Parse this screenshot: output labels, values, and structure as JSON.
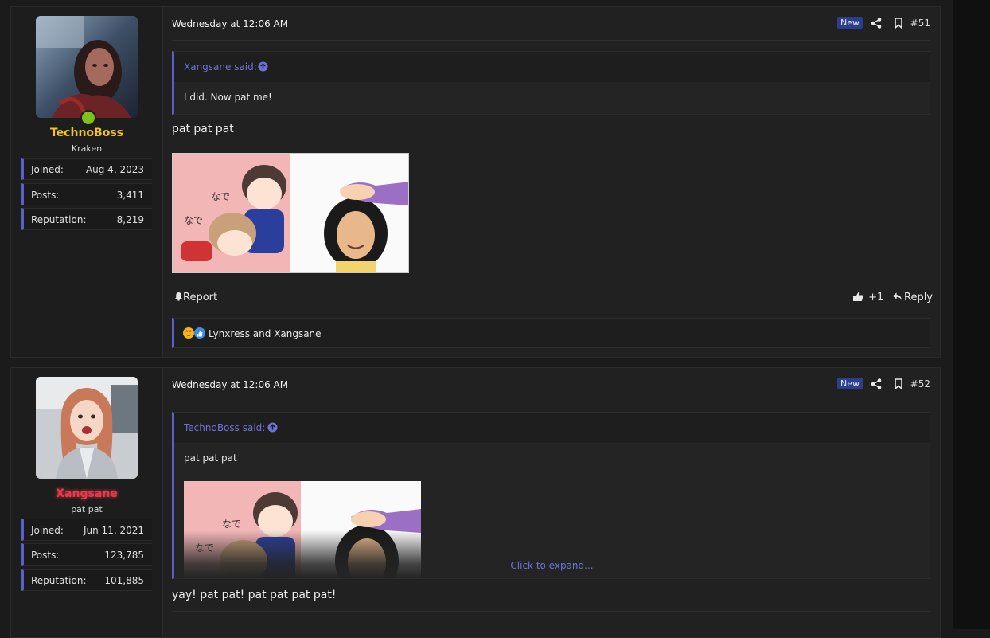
{
  "posts": [
    {
      "user": {
        "name": "TechnoBoss",
        "name_color": "#f5c518",
        "title": "Kraken",
        "online": true,
        "stats": [
          {
            "label": "Joined:",
            "value": "Aug 4, 2023"
          },
          {
            "label": "Posts:",
            "value": "3,411"
          },
          {
            "label": "Reputation:",
            "value": "8,219"
          }
        ]
      },
      "date": "Wednesday at 12:06 AM",
      "badge": "New",
      "number": "#51",
      "quote": {
        "author": "Xangsane said:",
        "text": "I did. Now pat me!"
      },
      "message": "pat pat pat",
      "actions": {
        "report": "Report",
        "like_count": "+1",
        "reply": "Reply"
      },
      "reactions": "Lynxress and Xangsane"
    },
    {
      "user": {
        "name": "Xangsane",
        "name_color": "#e53b4c",
        "title": "pat pat",
        "online": false,
        "stats": [
          {
            "label": "Joined:",
            "value": "Jun 11, 2021"
          },
          {
            "label": "Posts:",
            "value": "123,785"
          },
          {
            "label": "Reputation:",
            "value": "101,885"
          }
        ]
      },
      "date": "Wednesday at 12:06 AM",
      "badge": "New",
      "number": "#52",
      "quote": {
        "author": "TechnoBoss said:",
        "text": "pat pat pat",
        "expand": "Click to expand..."
      },
      "message": "yay! pat pat! pat pat pat pat!"
    }
  ],
  "colors": {
    "accent": "#5b5fc7",
    "link": "#6c72d8",
    "badge_bg": "#2b3f8f",
    "online": "#80c01a"
  },
  "icons": [
    "share-icon",
    "bookmark-icon",
    "arrow-up-circle-icon",
    "bell-icon",
    "thumbs-up-icon",
    "reply-icon"
  ]
}
